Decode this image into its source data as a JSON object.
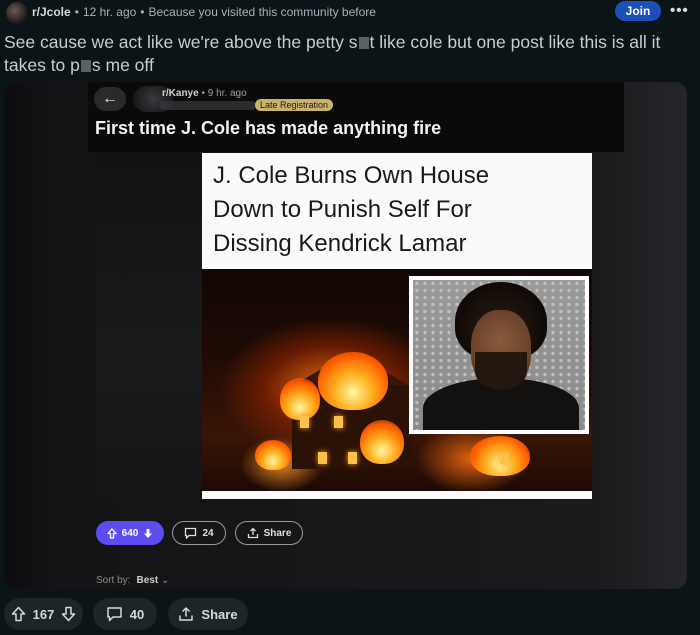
{
  "post": {
    "subreddit": "r/Jcole",
    "age": "12 hr. ago",
    "reason": "Because you visited this community before",
    "join_label": "Join",
    "more_label": "•••",
    "title_part1": "See cause we act like we're above the petty s",
    "title_part2": "t like cole but one post like this is all it takes to p",
    "title_part3": "s me off"
  },
  "embed": {
    "back_glyph": "←",
    "subreddit": "r/Kanye",
    "age": "9 hr. ago",
    "flair": "Late Registration",
    "title": "First time J. Cole has made anything fire",
    "headline_line1": "J. Cole Burns Own House",
    "headline_line2": "Down to Punish Self For",
    "headline_line3": "Dissing Kendrick Lamar",
    "vote_count": "640",
    "comment_count": "24",
    "share_label": "Share",
    "sort_label": "Sort by:",
    "sort_value": "Best"
  },
  "actions": {
    "vote_count": "167",
    "comment_count": "40",
    "share_label": "Share"
  },
  "colors": {
    "background": "#0b1416",
    "join": "#1d4fb8",
    "upvote_active": "#5b4df0",
    "flair": "#c9b36b"
  }
}
